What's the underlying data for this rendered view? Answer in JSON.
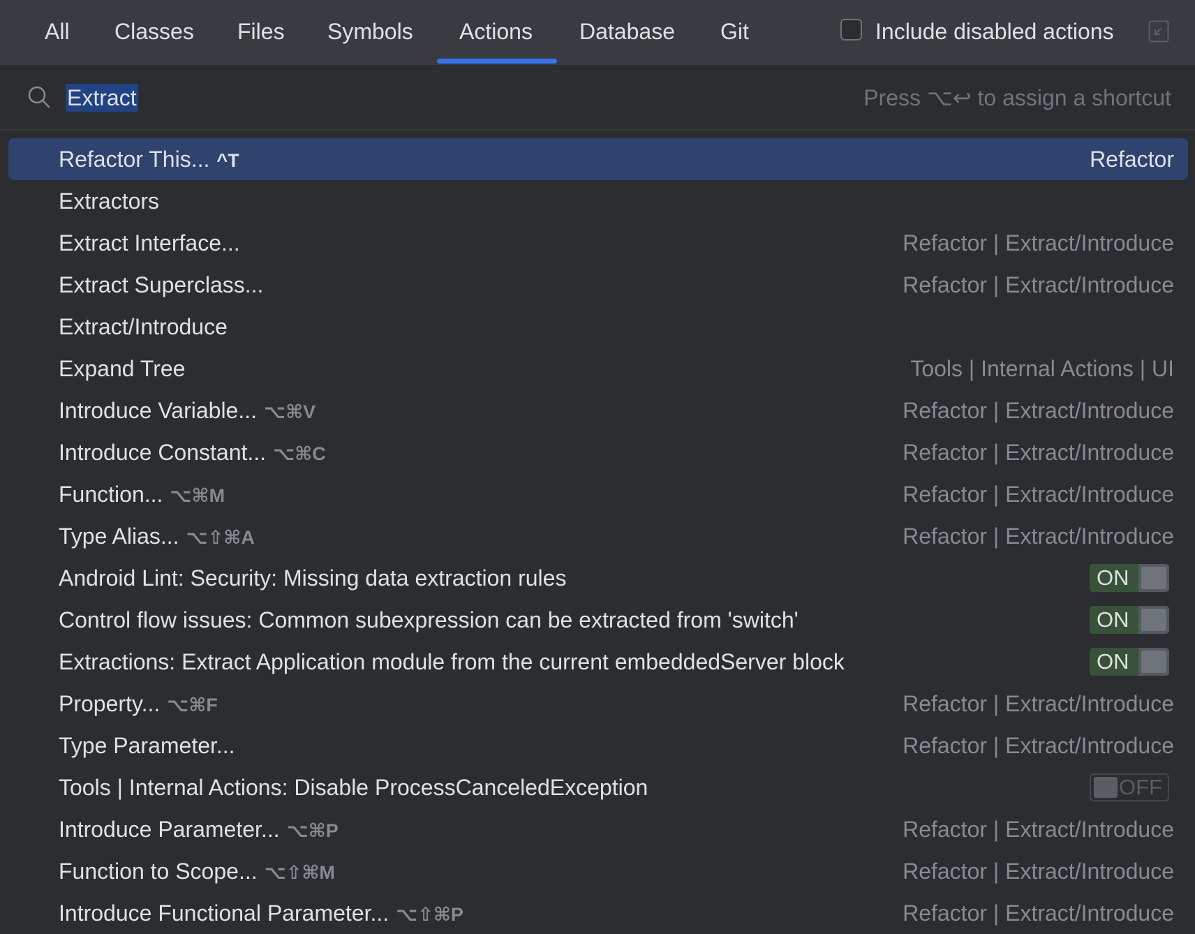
{
  "tabs": [
    {
      "label": "All"
    },
    {
      "label": "Classes"
    },
    {
      "label": "Files"
    },
    {
      "label": "Symbols"
    },
    {
      "label": "Actions",
      "active": true
    },
    {
      "label": "Database"
    },
    {
      "label": "Git"
    }
  ],
  "include_disabled_label": "Include disabled actions",
  "search": {
    "value": "Extract",
    "hint": "Press ⌥↩ to assign a shortcut"
  },
  "results": [
    {
      "name": "Refactor This...",
      "shortcut": "^T",
      "location": "Refactor",
      "selected": true
    },
    {
      "name": "Extractors",
      "shortcut": "",
      "location": ""
    },
    {
      "name": "Extract Interface...",
      "shortcut": "",
      "location": "Refactor | Extract/Introduce"
    },
    {
      "name": "Extract Superclass...",
      "shortcut": "",
      "location": "Refactor | Extract/Introduce"
    },
    {
      "name": "Extract/Introduce",
      "shortcut": "",
      "location": ""
    },
    {
      "name": "Expand Tree",
      "shortcut": "",
      "location": "Tools | Internal Actions | UI"
    },
    {
      "name": "Introduce Variable...",
      "shortcut": "⌥⌘V",
      "location": "Refactor | Extract/Introduce"
    },
    {
      "name": "Introduce Constant...",
      "shortcut": "⌥⌘C",
      "location": "Refactor | Extract/Introduce"
    },
    {
      "name": "Function...",
      "shortcut": "⌥⌘M",
      "location": "Refactor | Extract/Introduce"
    },
    {
      "name": "Type Alias...",
      "shortcut": "⌥⇧⌘A",
      "location": "Refactor | Extract/Introduce"
    },
    {
      "name": "Android Lint: Security: Missing data extraction rules",
      "shortcut": "",
      "toggle": "ON"
    },
    {
      "name": "Control flow issues: Common subexpression can be extracted from 'switch'",
      "shortcut": "",
      "toggle": "ON"
    },
    {
      "name": "Extractions: Extract Application module from the current embeddedServer block",
      "shortcut": "",
      "toggle": "ON"
    },
    {
      "name": "Property...",
      "shortcut": "⌥⌘F",
      "location": "Refactor | Extract/Introduce"
    },
    {
      "name": "Type Parameter...",
      "shortcut": "",
      "location": "Refactor | Extract/Introduce"
    },
    {
      "name": "Tools | Internal Actions: Disable ProcessCanceledException",
      "shortcut": "",
      "toggle": "OFF"
    },
    {
      "name": "Introduce Parameter...",
      "shortcut": "⌥⌘P",
      "location": "Refactor | Extract/Introduce"
    },
    {
      "name": "Function to Scope...",
      "shortcut": "⌥⇧⌘M",
      "location": "Refactor | Extract/Introduce"
    },
    {
      "name": "Introduce Functional Parameter...",
      "shortcut": "⌥⇧⌘P",
      "location": "Refactor | Extract/Introduce"
    }
  ]
}
